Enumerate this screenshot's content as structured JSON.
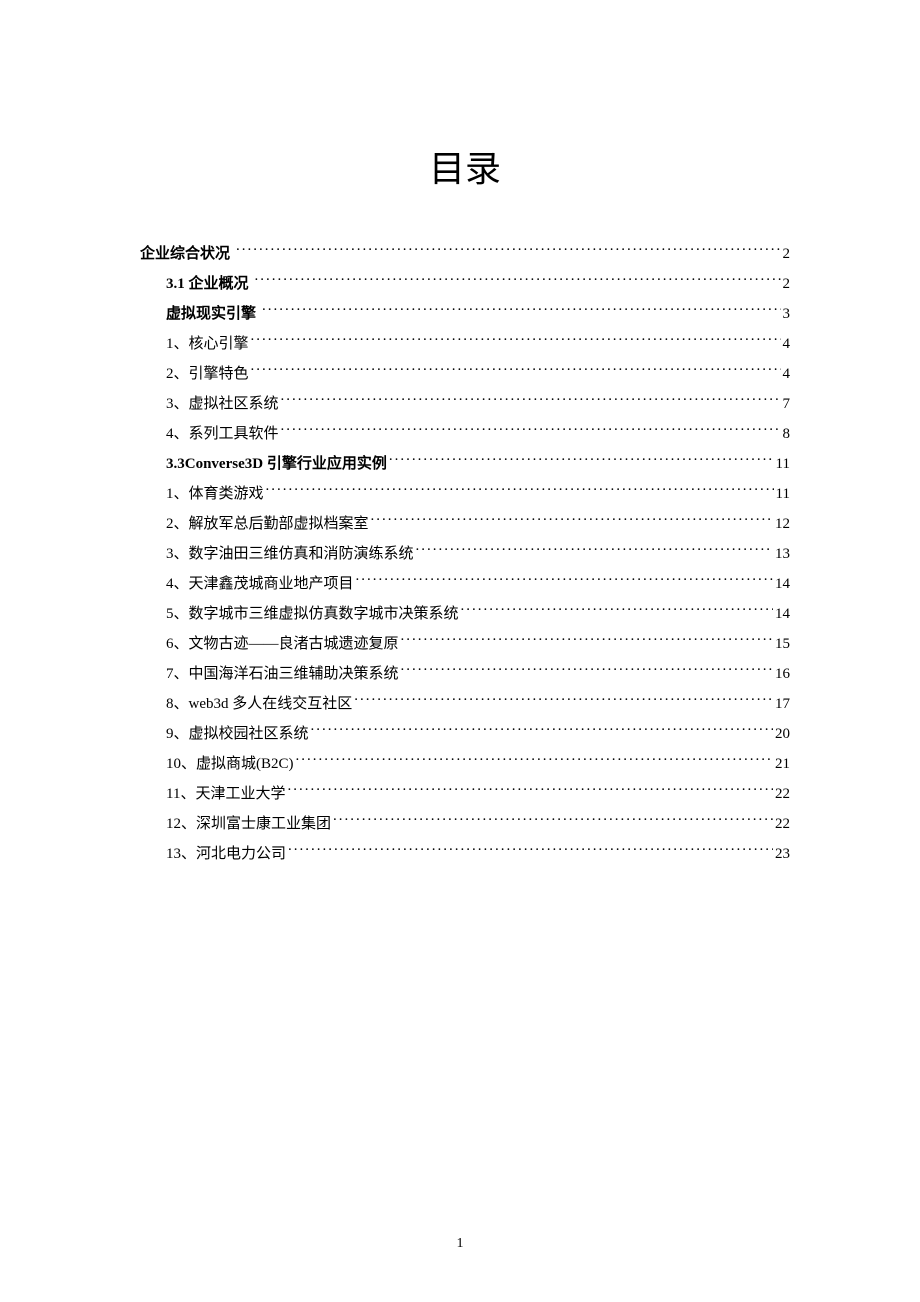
{
  "title": "目录",
  "page_number": "1",
  "toc": [
    {
      "level": 0,
      "bold": true,
      "label": "企业综合状况",
      "page": "2",
      "label_trailing_space": true
    },
    {
      "level": 1,
      "bold": true,
      "label": "3.1 企业概况",
      "page": "2",
      "label_trailing_space": true
    },
    {
      "level": 1,
      "bold": true,
      "label": "虚拟现实引擎",
      "page": "3",
      "label_trailing_space": true
    },
    {
      "level": 1,
      "bold": false,
      "label": "1、核心引擎",
      "page": "4",
      "label_trailing_space": false
    },
    {
      "level": 1,
      "bold": false,
      "label": "2、引擎特色",
      "page": "4",
      "label_trailing_space": false
    },
    {
      "level": 1,
      "bold": false,
      "label": "3、虚拟社区系统",
      "page": "7",
      "label_trailing_space": false
    },
    {
      "level": 1,
      "bold": false,
      "label": "4、系列工具软件",
      "page": "8",
      "label_trailing_space": false
    },
    {
      "level": 1,
      "bold": true,
      "label": "3.3Converse3D 引擎行业应用实例",
      "page": "11",
      "label_trailing_space": false
    },
    {
      "level": 1,
      "bold": false,
      "label": "1、体育类游戏",
      "page": "11",
      "label_trailing_space": false
    },
    {
      "level": 1,
      "bold": false,
      "label": "2、解放军总后勤部虚拟档案室",
      "page": "12",
      "label_trailing_space": false
    },
    {
      "level": 1,
      "bold": false,
      "label": "3、数字油田三维仿真和消防演练系统",
      "page": "13",
      "label_trailing_space": false
    },
    {
      "level": 1,
      "bold": false,
      "label": "4、天津鑫茂城商业地产项目",
      "page": "14",
      "label_trailing_space": false
    },
    {
      "level": 1,
      "bold": false,
      "label": "5、数字城市三维虚拟仿真数字城市决策系统",
      "page": "14",
      "label_trailing_space": false
    },
    {
      "level": 1,
      "bold": false,
      "label": "6、文物古迹——良渚古城遗迹复原",
      "page": "15",
      "label_trailing_space": false
    },
    {
      "level": 1,
      "bold": false,
      "label": "7、中国海洋石油三维辅助决策系统",
      "page": "16",
      "label_trailing_space": false
    },
    {
      "level": 1,
      "bold": false,
      "label": "8、web3d 多人在线交互社区",
      "page": "17",
      "label_trailing_space": false
    },
    {
      "level": 1,
      "bold": false,
      "label": "9、虚拟校园社区系统",
      "page": "20",
      "label_trailing_space": false
    },
    {
      "level": 1,
      "bold": false,
      "label": "10、虚拟商城(B2C)",
      "page": "21",
      "label_trailing_space": false
    },
    {
      "level": 1,
      "bold": false,
      "label": "11、天津工业大学",
      "page": "22",
      "label_trailing_space": false
    },
    {
      "level": 1,
      "bold": false,
      "label": "12、深圳富士康工业集团",
      "page": "22",
      "label_trailing_space": false
    },
    {
      "level": 1,
      "bold": false,
      "label": "13、河北电力公司",
      "page": "23",
      "label_trailing_space": false
    }
  ]
}
